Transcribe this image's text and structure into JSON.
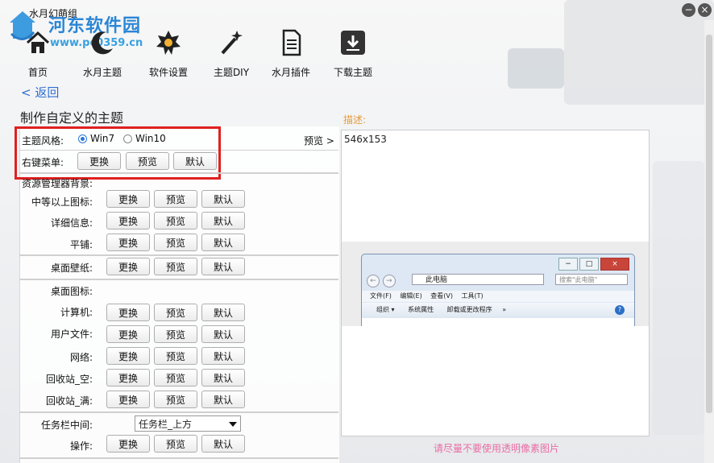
{
  "window": {
    "title": "水月幻萌组"
  },
  "watermark": {
    "site_name": "河东软件园",
    "url": "www.pc0359.cn"
  },
  "toolbar": [
    {
      "label": "首页",
      "icon": "home-icon"
    },
    {
      "label": "水月主题",
      "icon": "moon-icon"
    },
    {
      "label": "软件设置",
      "icon": "gear-icon"
    },
    {
      "label": "主题DIY",
      "icon": "magic-wand-icon"
    },
    {
      "label": "水月插件",
      "icon": "document-icon"
    },
    {
      "label": "下载主题",
      "icon": "download-icon"
    }
  ],
  "nav": {
    "back_label": "< 返回"
  },
  "page": {
    "heading": "制作自定义的主题"
  },
  "theme_style": {
    "label": "主题风格:",
    "options": [
      "Win7",
      "Win10"
    ],
    "selected": "Win7",
    "preview_link": "预览 >"
  },
  "context_menu": {
    "label": "右键菜单:"
  },
  "buttons": {
    "change": "更换",
    "preview": "预览",
    "default": "默认"
  },
  "explorer_bg": {
    "label": "资源管理器背景:",
    "rows": [
      "中等以上图标:",
      "详细信息:",
      "平铺:"
    ]
  },
  "wallpaper": {
    "label": "桌面壁纸:"
  },
  "desktop_icons": {
    "label": "桌面图标:",
    "rows": [
      "计算机:",
      "用户文件:",
      "网络:",
      "回收站_空:",
      "回收站_满:"
    ]
  },
  "taskbar": {
    "label": "任务栏中间:",
    "selected": "任务栏_上方",
    "action_label": "操作:"
  },
  "preview": {
    "desc_label": "描述:",
    "size_text": "546x153",
    "hint": "请尽量不要使用透明像素图片",
    "explorer": {
      "address": "此电脑",
      "search_placeholder": "搜索\"此电脑\"",
      "menu": [
        "文件(F)",
        "编辑(E)",
        "查看(V)",
        "工具(T)"
      ],
      "commands": [
        "组织 ▾",
        "系统属性",
        "卸载或更改程序",
        "»"
      ]
    }
  },
  "colors": {
    "accent": "#2b78d8",
    "highlight": "#e02020",
    "hint": "#ea6ca6",
    "desc": "#e69a3a"
  }
}
